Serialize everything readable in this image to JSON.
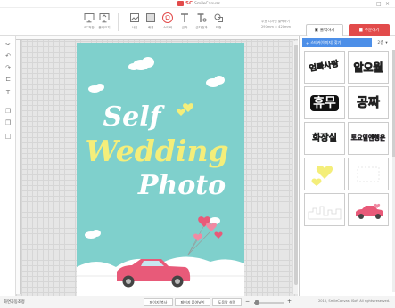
{
  "app": {
    "brand_name": "SmileCanvas",
    "logo_text": "SC",
    "accent_color": "#e24b4b"
  },
  "toolbar": {
    "tools": [
      {
        "label": "PC저장",
        "icon": "monitor-save-icon"
      },
      {
        "label": "불러오기",
        "icon": "folder-open-icon"
      },
      {
        "label": "사진",
        "icon": "photo-icon"
      },
      {
        "label": "배경",
        "icon": "background-icon"
      },
      {
        "label": "스티커",
        "icon": "sticker-icon",
        "active": true
      },
      {
        "label": "글자",
        "icon": "text-icon"
      },
      {
        "label": "글자효과",
        "icon": "text-effect-icon"
      },
      {
        "label": "도형",
        "icon": "shape-icon"
      }
    ],
    "info_line1": "우표 디자인 출력하기",
    "info_line2": "297mm × 420mm",
    "export_label": "출력하기",
    "order_label": "주문하기"
  },
  "left_tools": [
    "cut-icon",
    "undo-icon",
    "redo-icon",
    "crop-icon",
    "text-cursor-icon",
    "copy-icon",
    "paste-icon",
    "fit-icon"
  ],
  "poster": {
    "bg_color": "#7fd0cc",
    "line1": "Self",
    "line2": "Wedding",
    "line3": "Photo",
    "line1_color": "#ffffff",
    "line2_color": "#f4ee7a",
    "line3_color": "#ffffff",
    "car_color": "#e85a79"
  },
  "right_panel": {
    "tab_label": "스티커(이미지) 찾기",
    "count_label": "2층",
    "stickers": [
      {
        "text": "엄빠사랑",
        "style": "rainbow"
      },
      {
        "text": "알오월",
        "style": "yellow-black"
      },
      {
        "text": "휴무",
        "style": "black-white"
      },
      {
        "text": "공짜",
        "style": "pink-black"
      },
      {
        "text": "화장실",
        "style": "green-pink"
      },
      {
        "text": "토요일엔행운",
        "style": "purple-pink"
      },
      {
        "text": "",
        "style": "yellow-hearts"
      },
      {
        "text": "",
        "style": "white-outline"
      },
      {
        "text": "",
        "style": "white-skyline"
      },
      {
        "text": "",
        "style": "pink-car"
      }
    ]
  },
  "statusbar": {
    "left_label": "화면자동조정",
    "copy_page_label": "페이지 복사",
    "paste_page_label": "페이지 붙여넣기",
    "help_label": "도움말 설명",
    "copyright": "2015, SmileCanvas, ISoft All rights reserved."
  }
}
